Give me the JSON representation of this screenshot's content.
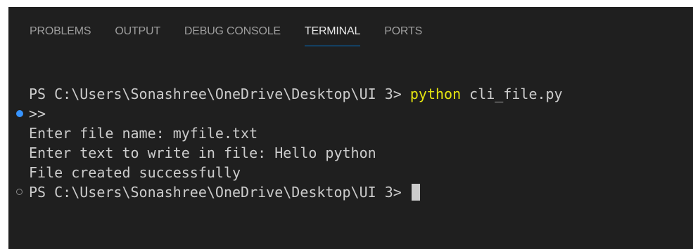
{
  "tabs": [
    {
      "label": "PROBLEMS"
    },
    {
      "label": "OUTPUT"
    },
    {
      "label": "DEBUG CONSOLE"
    },
    {
      "label": "TERMINAL"
    },
    {
      "label": "PORTS"
    }
  ],
  "active_tab": "TERMINAL",
  "terminal": {
    "prompt1": "PS C:\\Users\\Sonashree\\OneDrive\\Desktop\\UI 3> ",
    "command1_name": "python",
    "command1_args": " cli_file.py",
    "continuation": ">>",
    "output1": "Enter file name: myfile.txt",
    "output2": "Enter text to write in file: Hello python",
    "output3": "File created successfully",
    "prompt2": "PS C:\\Users\\Sonashree\\OneDrive\\Desktop\\UI 3> "
  },
  "colors": {
    "background": "#1f1f1f",
    "text": "#cccccc",
    "command": "#e5e510",
    "tab_inactive": "#9d9d9d",
    "tab_active_underline": "#0078d4",
    "decoration_success": "#3794ff"
  }
}
